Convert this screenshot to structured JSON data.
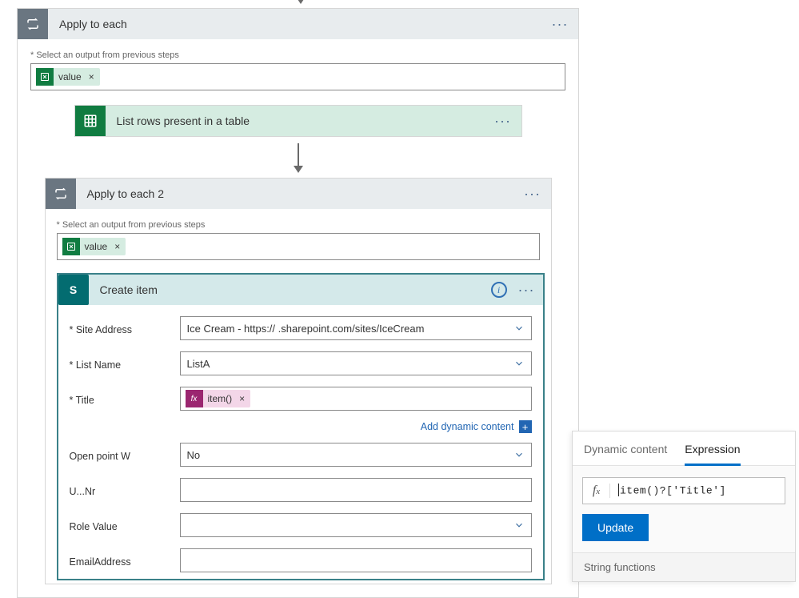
{
  "outer": {
    "title": "Apply to each",
    "menu": "···",
    "select_label": "Select an output from previous steps",
    "chip_value": "value",
    "chip_close": "×",
    "excel_card": {
      "title": "List rows present in a table",
      "menu": "···"
    }
  },
  "inner": {
    "title": "Apply to each 2",
    "menu": "···",
    "select_label": "Select an output from previous steps",
    "chip_value": "value",
    "chip_close": "×"
  },
  "sp": {
    "title": "Create item",
    "menu": "···",
    "labels": {
      "site": "Site Address",
      "list": "List Name",
      "title": "Title",
      "openw": "Open point W",
      "unr": "U...Nr",
      "role": "Role Value",
      "email": "EmailAddress"
    },
    "values": {
      "site": "Ice Cream - https://       .sharepoint.com/sites/IceCream",
      "list": "ListA",
      "title_fx": "item()",
      "openw": "No"
    },
    "add_dynamic": "Add dynamic content"
  },
  "expr": {
    "tab_dynamic": "Dynamic content",
    "tab_expression": "Expression",
    "value": "item()?['Title']",
    "update": "Update",
    "section_string": "String functions"
  }
}
